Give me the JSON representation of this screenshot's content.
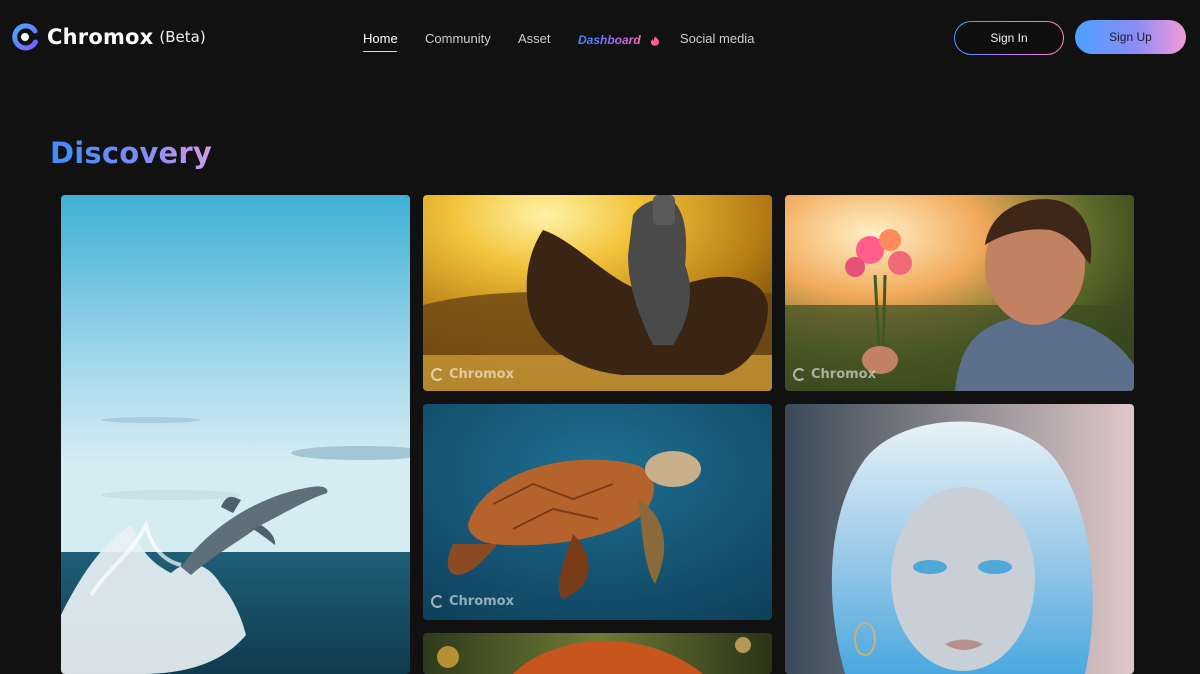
{
  "brand": {
    "name": "Chromox",
    "badge": "(Beta)",
    "icon": "chromox-logo-icon"
  },
  "nav": {
    "items": [
      {
        "label": "Home",
        "active": true
      },
      {
        "label": "Community"
      },
      {
        "label": "Asset"
      },
      {
        "label": "Dashboard",
        "icon": "flame-icon"
      },
      {
        "label": "Social media"
      }
    ]
  },
  "auth": {
    "signin": "Sign In",
    "signup": "Sign Up"
  },
  "section": {
    "title": "Discovery"
  },
  "gallery": {
    "watermark": "Chromox",
    "images": [
      {
        "subject": "dolphin-leaping"
      },
      {
        "subject": "armored-knight-on-horse"
      },
      {
        "subject": "man-holding-flowers"
      },
      {
        "subject": "sea-turtle"
      },
      {
        "subject": "blue-haired-woman"
      },
      {
        "subject": "red-haired-portrait"
      }
    ]
  },
  "colors": {
    "background": "#111112",
    "accent_blue": "#3c8cff",
    "accent_pink": "#f39bd8"
  }
}
